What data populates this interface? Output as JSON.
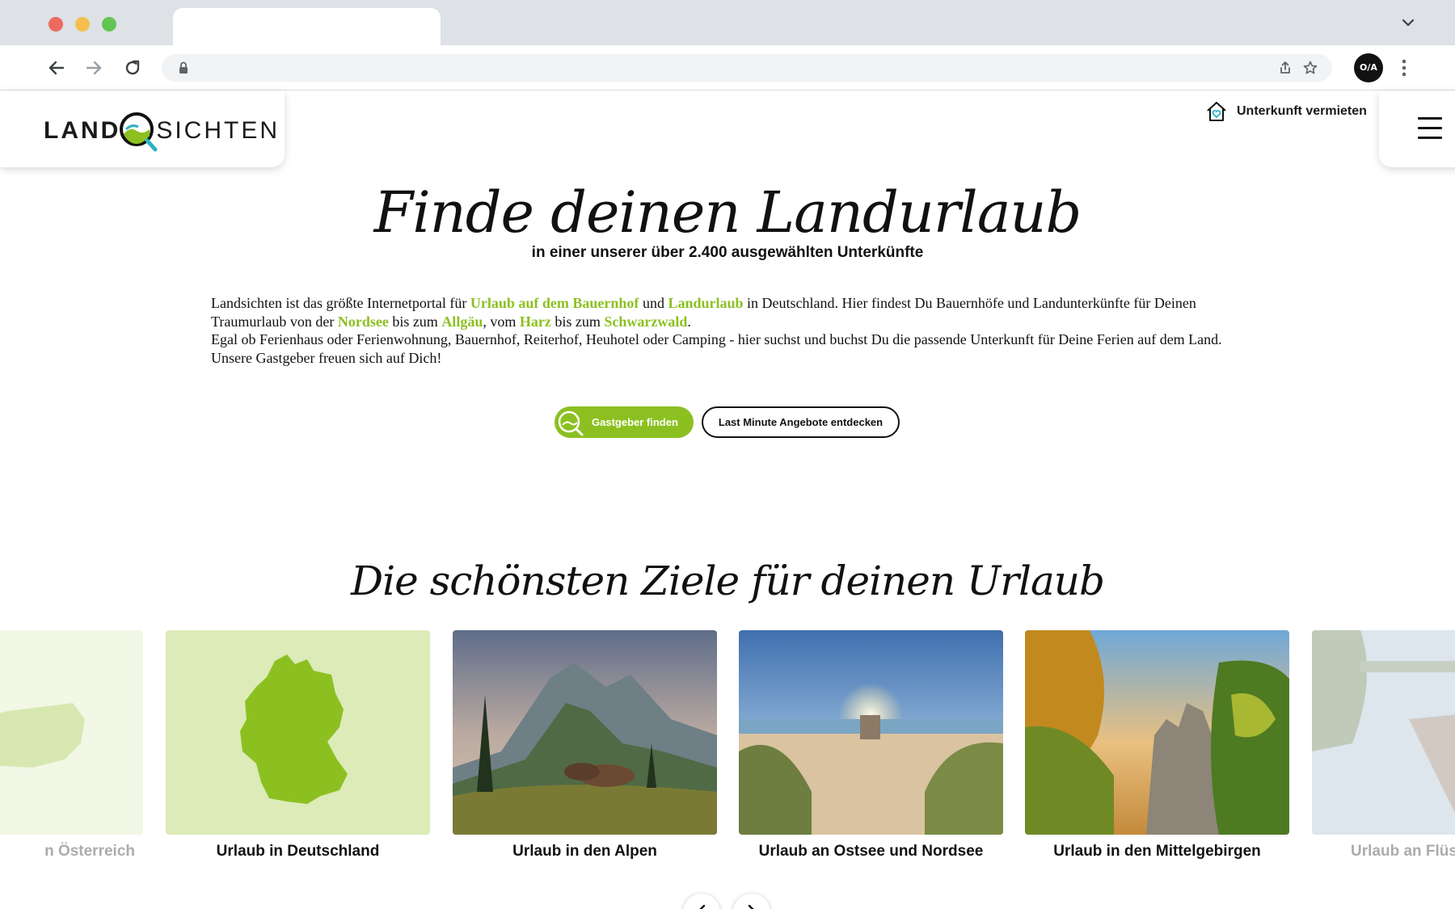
{
  "site": {
    "logo_left": "LAND",
    "logo_right": "SICHTEN",
    "rent_link": "Unterkunft vermieten"
  },
  "browser": {
    "profile_label": "O/A"
  },
  "hero": {
    "title": "Finde deinen Landurlaub",
    "subtitle": "in einer unserer über 2.400 ausgewählten Unterkünfte",
    "intro": {
      "t1": "Landsichten ist das größte Internetportal für ",
      "l1": "Urlaub auf dem Bauernhof",
      "t2": " und ",
      "l2": "Landurlaub",
      "t3": " in Deutschland. Hier findest Du Bauernhöfe und Landunterkünfte für Deinen Traumurlaub von der ",
      "l3": "Nordsee",
      "t4": " bis zum ",
      "l4": "Allgäu",
      "t5": ", vom ",
      "l5": "Harz",
      "t6": " bis zum ",
      "l6": "Schwarzwald",
      "t7": ".",
      "line2": "Egal ob Ferienhaus oder Ferienwohnung, Bauernhof, Reiterhof, Heuhotel oder Camping - hier suchst und buchst Du die passende Unterkunft für Deine Ferien auf dem Land.",
      "line3": "Unsere Gastgeber freuen sich auf Dich!"
    },
    "btn_primary": "Gastgeber finden",
    "btn_secondary": "Last Minute Angebote entdecken"
  },
  "destinations": {
    "title": "Die schönsten Ziele für deinen Urlaub",
    "cards": [
      {
        "label": "Urlaub in Österreich",
        "shown": "n Österreich"
      },
      {
        "label": "Urlaub in Deutschland"
      },
      {
        "label": "Urlaub in den Alpen"
      },
      {
        "label": "Urlaub an Ostsee und Nordsee"
      },
      {
        "label": "Urlaub in den Mittelgebirgen"
      },
      {
        "label": "Urlaub an Flüssen",
        "shown": "Urlaub an Flüss"
      }
    ]
  },
  "colors": {
    "accent": "#8cc021",
    "map_bg": "#dcebb8",
    "map_fill": "#8cc021"
  }
}
